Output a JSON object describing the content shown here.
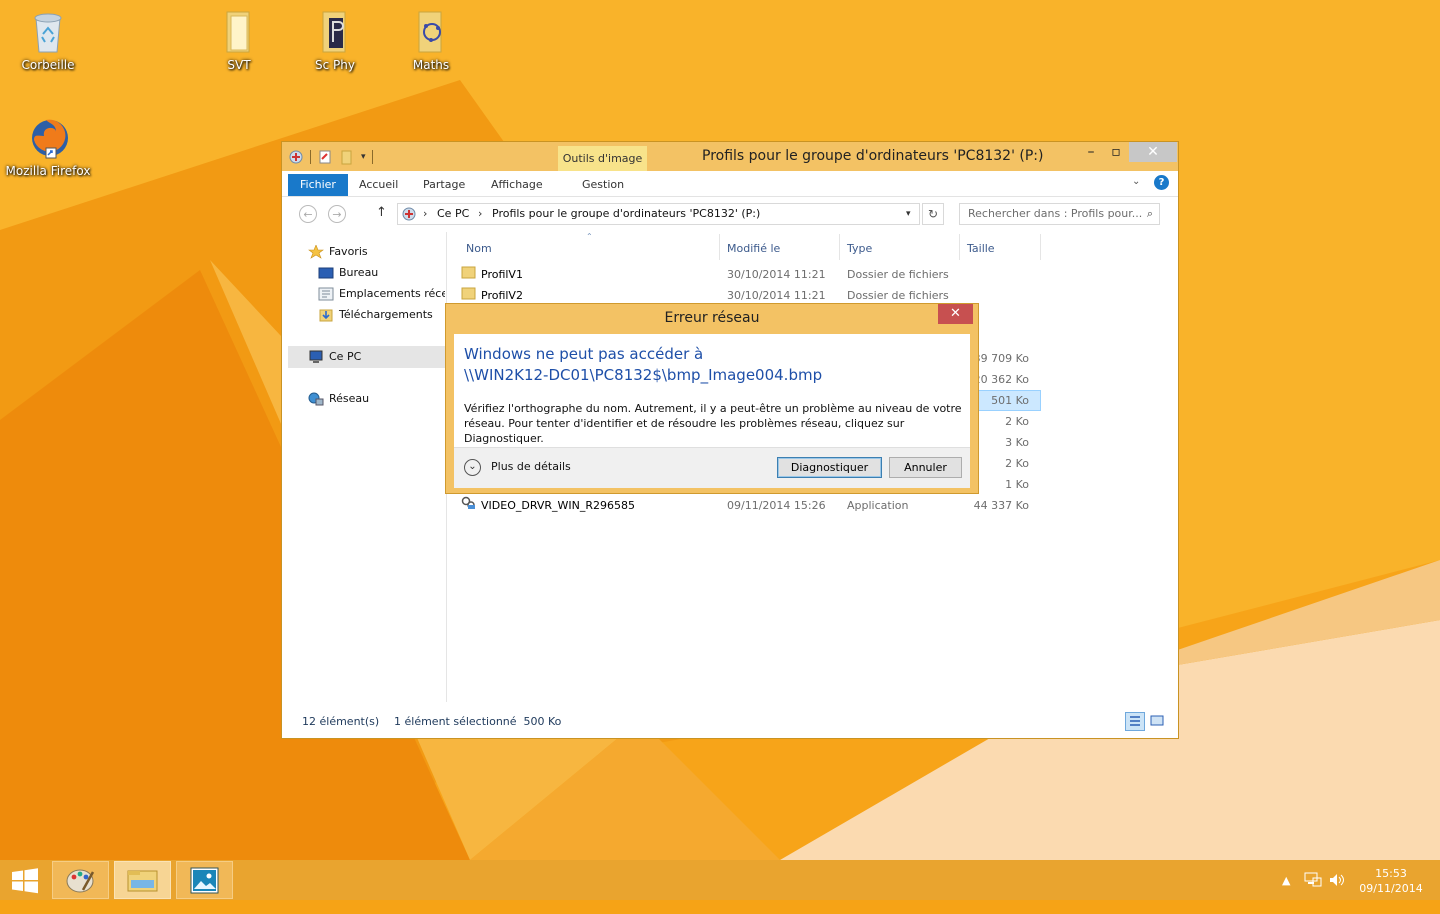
{
  "desktop": {
    "icons": [
      {
        "label": "Corbeille"
      },
      {
        "label": "SVT"
      },
      {
        "label": "Sc Phy"
      },
      {
        "label": "Maths"
      },
      {
        "label": "Mozilla Firefox"
      }
    ]
  },
  "explorer": {
    "context_tab": "Outils d'image",
    "title": "Profils pour le groupe d'ordinateurs 'PC8132' (P:)",
    "ribbon_tabs": [
      "Fichier",
      "Accueil",
      "Partage",
      "Affichage",
      "Gestion"
    ],
    "breadcrumb": [
      "Ce PC",
      "Profils pour le groupe d'ordinateurs 'PC8132' (P:)"
    ],
    "search_placeholder": "Rechercher dans : Profils pour...",
    "nav": {
      "favorites": "Favoris",
      "favorites_items": [
        "Bureau",
        "Emplacements récents",
        "Téléchargements"
      ],
      "this_pc": "Ce PC",
      "network": "Réseau"
    },
    "columns": {
      "name": "Nom",
      "modified": "Modifié le",
      "type": "Type",
      "size": "Taille"
    },
    "rows": [
      {
        "name": "ProfilV1",
        "modified": "30/10/2014 11:21",
        "type": "Dossier de fichiers",
        "size": ""
      },
      {
        "name": "ProfilV2",
        "modified": "30/10/2014 11:21",
        "type": "Dossier de fichiers",
        "size": ""
      }
    ],
    "partial_sizes": [
      "39 709 Ko",
      "20 362 Ko",
      "501 Ko",
      "2 Ko",
      "3 Ko",
      "2 Ko",
      "1 Ko"
    ],
    "last_row": {
      "name": "VIDEO_DRVR_WIN_R296585",
      "modified": "09/11/2014 15:26",
      "type": "Application",
      "size": "44 337 Ko"
    },
    "status": {
      "count": "12 élément(s)",
      "selected": "1 élément sélectionné  500 Ko"
    }
  },
  "dialog": {
    "title": "Erreur réseau",
    "main_line1": "Windows ne peut pas accéder à",
    "main_line2": "\\\\WIN2K12-DC01\\PC8132$\\bmp_Image004.bmp",
    "description": "Vérifiez l'orthographe du nom. Autrement, il y a peut-être un problème au niveau de votre réseau. Pour tenter d'identifier et de résoudre les problèmes réseau, cliquez sur Diagnostiquer.",
    "details_label": "Plus de détails",
    "diagnose_label": "Diagnostiquer",
    "cancel_label": "Annuler"
  },
  "taskbar": {
    "time": "15:53",
    "date": "09/11/2014"
  },
  "colors": {
    "desktop": "#f6a316",
    "titlebar": "#f3c264",
    "accent": "#1979ca",
    "close": "#c75050"
  }
}
